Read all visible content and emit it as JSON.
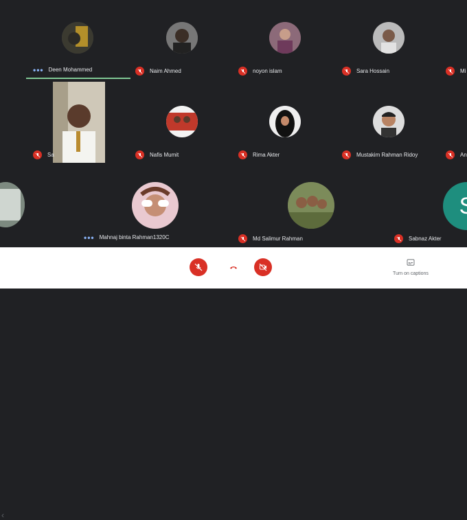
{
  "participants": [
    {
      "name": "Deen Mohammed",
      "status": "speaking"
    },
    {
      "name": "Naim Ahmed",
      "status": "muted"
    },
    {
      "name": "noyon islam",
      "status": "muted"
    },
    {
      "name": "Sara Hossain",
      "status": "muted"
    },
    {
      "name": "Mi",
      "status": "muted"
    },
    {
      "name": "Sa",
      "status": "muted"
    },
    {
      "name": "Nafis Mumit",
      "status": "muted"
    },
    {
      "name": "Rima Akter",
      "status": "muted"
    },
    {
      "name": "Mustakim Rahman Ridoy",
      "status": "muted"
    },
    {
      "name": "An",
      "status": "muted"
    },
    {
      "name": "Mahnaj binta Rahman1320C",
      "status": "speaking"
    },
    {
      "name": "Md Salimur Rahman",
      "status": "muted"
    },
    {
      "name": "Sabnaz Akter",
      "status": "muted"
    }
  ],
  "speaking_indicator": "•••",
  "letter_avatar": "S",
  "controls": {
    "mic_icon": "mic-off-icon",
    "hangup_icon": "call-end-icon",
    "camera_icon": "camera-off-icon",
    "captions_label": "Turn on captions",
    "captions_icon": "captions-icon"
  },
  "colors": {
    "background": "#202124",
    "muted_badge": "#d93025",
    "speaking_dots": "#8ab4f8",
    "speaking_bar": "#81c995",
    "letter_avatar": "#1e8e7e"
  }
}
